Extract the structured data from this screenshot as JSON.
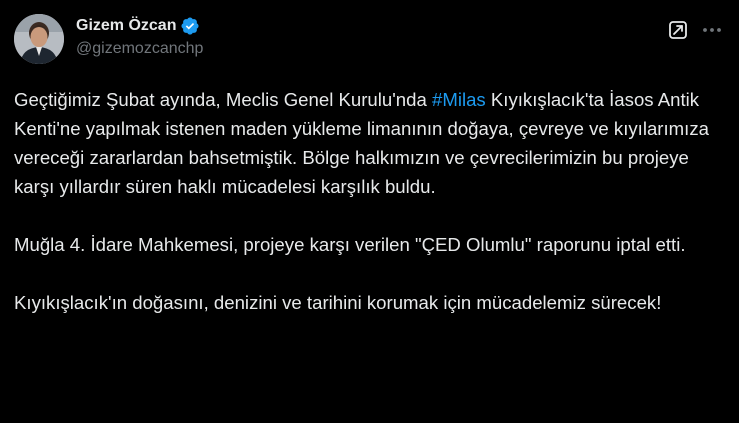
{
  "author": {
    "display_name": "Gizem Özcan",
    "handle": "@gizemozcanchp",
    "verified": true
  },
  "icons": {
    "verified": "verified-badge-icon",
    "grok": "grok-icon",
    "more": "more-options-icon"
  },
  "colors": {
    "background": "#000000",
    "text": "#e7e9ea",
    "secondary_text": "#71767b",
    "accent": "#1d9bf0"
  },
  "tweet": {
    "p1_before": "Geçtiğimiz Şubat ayında, Meclis Genel Kurulu'nda ",
    "p1_hashtag": "#Milas",
    "p1_after": " Kıyıkışlacık'ta İasos Antik Kenti'ne yapılmak istenen maden yükleme limanının doğaya, çevreye ve kıyılarımıza vereceği zararlardan bahsetmiştik. Bölge halkımızın ve çevrecilerimizin bu projeye karşı yıllardır süren haklı mücadelesi karşılık buldu.",
    "p2": "Muğla 4. İdare Mahkemesi, projeye karşı verilen \"ÇED Olumlu\" raporunu iptal etti.",
    "p3": "Kıyıkışlacık'ın doğasını, denizini ve tarihini korumak için mücadelemiz sürecek!"
  }
}
